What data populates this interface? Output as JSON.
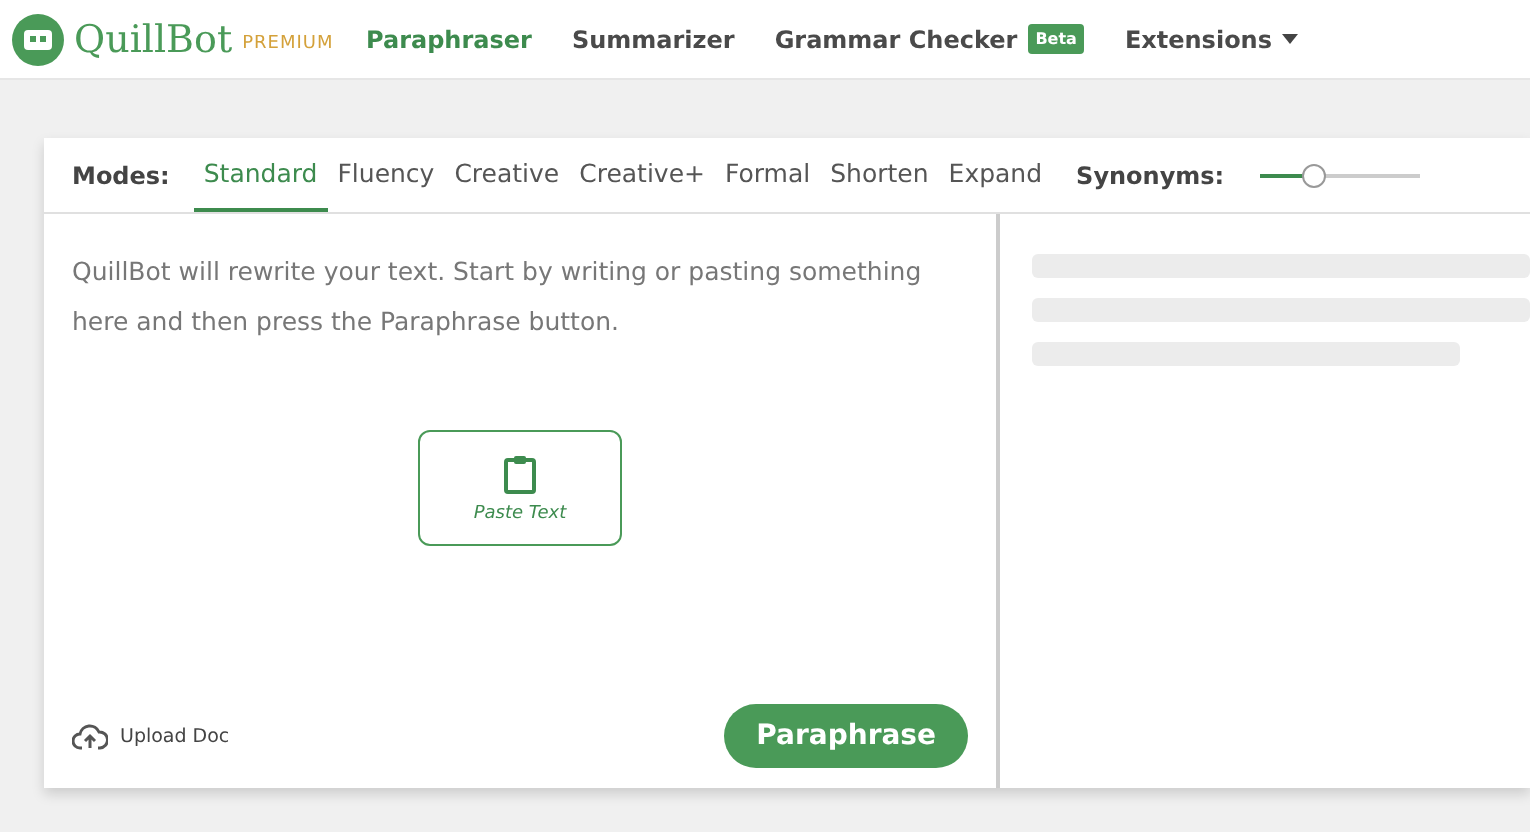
{
  "brand": {
    "name": "QuillBot",
    "tier": "PREMIUM"
  },
  "nav": [
    {
      "label": "Paraphraser",
      "selected": true
    },
    {
      "label": "Summarizer",
      "selected": false
    },
    {
      "label": "Grammar Checker",
      "selected": false,
      "badge": "Beta"
    },
    {
      "label": "Extensions",
      "selected": false,
      "dropdown": true
    }
  ],
  "modes": {
    "label": "Modes:",
    "items": [
      {
        "label": "Standard",
        "selected": true
      },
      {
        "label": "Fluency",
        "selected": false
      },
      {
        "label": "Creative",
        "selected": false
      },
      {
        "label": "Creative+",
        "selected": false
      },
      {
        "label": "Formal",
        "selected": false
      },
      {
        "label": "Shorten",
        "selected": false
      },
      {
        "label": "Expand",
        "selected": false
      }
    ]
  },
  "synonyms": {
    "label": "Synonyms:",
    "level": 0.33
  },
  "input": {
    "placeholder": "QuillBot will rewrite your text. Start by writing or pasting something here and then press the Paraphrase button.",
    "paste_button": "Paste Text",
    "upload": "Upload Doc",
    "submit": "Paraphrase"
  }
}
